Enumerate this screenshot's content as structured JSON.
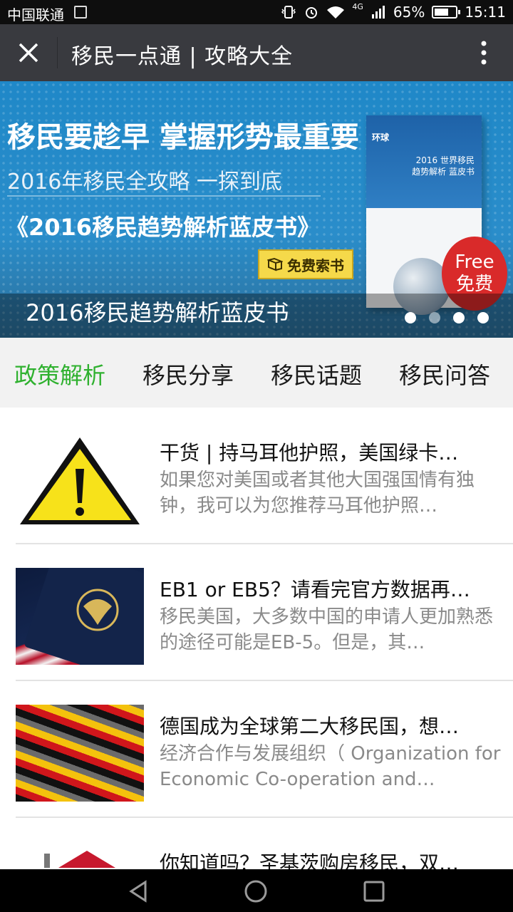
{
  "status_bar": {
    "carrier": "中国联通",
    "network": "4G",
    "battery": "65%",
    "battery_level": 0.65,
    "time": "15:11"
  },
  "header": {
    "title": "移民一点通 | 攻略大全"
  },
  "banner": {
    "headline": "移民要趁早 掌握形势最重要",
    "subline": "2016年移民全攻略 一探到底",
    "book_title": "《2016移民趋势解析蓝皮书》",
    "cta_label": "免费索书",
    "book_brand": "环球",
    "book_cover_text": "2016 世界移民趋势解析 蓝皮书",
    "free_badge_en": "Free",
    "free_badge_cn": "免费",
    "caption": "2016移民趋势解析蓝皮书",
    "page_count": 4,
    "current_page": 3
  },
  "tabs": [
    {
      "label": "政策解析",
      "active": true
    },
    {
      "label": "移民分享",
      "active": false
    },
    {
      "label": "移民话题",
      "active": false
    },
    {
      "label": "移民问答",
      "active": false
    }
  ],
  "articles": [
    {
      "title": "干货 | 持马耳他护照，美国绿卡…",
      "desc": "如果您对美国或者其他大国强国情有独钟，我可以为您推荐马耳他护照…",
      "thumb": "warning-sign"
    },
    {
      "title": "EB1 or EB5？请看完官方数据再…",
      "desc": "移民美国，大多数中国的申请人更加熟悉的途径可能是EB-5。但是，其…",
      "thumb": "us-passport"
    },
    {
      "title": "德国成为全球第二大移民国，想…",
      "desc": "经济合作与发展组织（ Organization for Economic Co-operation and…",
      "thumb": "german-flags"
    },
    {
      "title": "你知道吗？圣基茨购房移民，双…",
      "desc": "",
      "thumb": "house"
    }
  ],
  "colors": {
    "active_tab": "#2fb12f",
    "title_bar": "#393a3f"
  }
}
